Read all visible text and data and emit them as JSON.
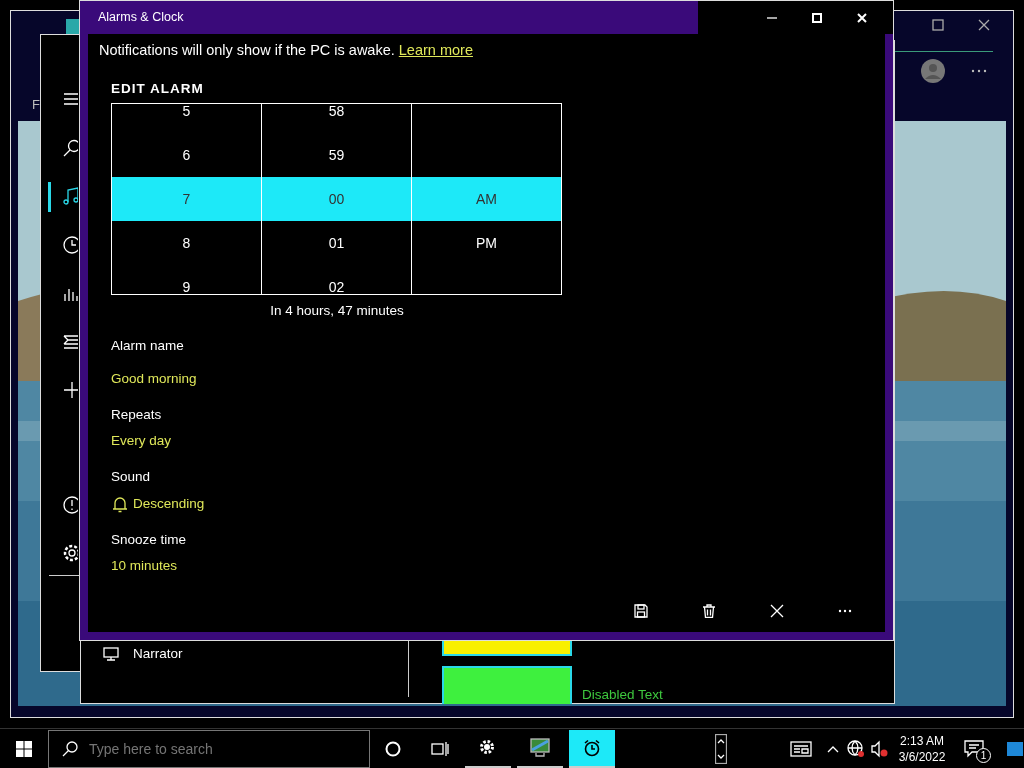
{
  "background_window": {
    "cut_text": "F",
    "narrator_label": "Narrator",
    "disabled_text": "Disabled Text"
  },
  "media_sidebar": [
    {
      "kind": "menu",
      "selected": false
    },
    {
      "kind": "search",
      "selected": false
    },
    {
      "kind": "music",
      "selected": true
    },
    {
      "kind": "clock",
      "selected": false
    },
    {
      "kind": "chart",
      "selected": false
    },
    {
      "kind": "list",
      "selected": false
    },
    {
      "kind": "add",
      "selected": false
    },
    {
      "kind": "info",
      "selected": false
    },
    {
      "kind": "settings",
      "selected": false
    }
  ],
  "window": {
    "title": "Alarms & Clock"
  },
  "notice": {
    "text": "Notifications will only show if the PC is awake.",
    "link": "Learn more"
  },
  "heading": "EDIT ALARM",
  "picker_rows": [
    {
      "hour": "5",
      "minute": "58",
      "selected": false
    },
    {
      "hour": "6",
      "minute": "59",
      "selected": false
    },
    {
      "hour": "7",
      "minute": "00",
      "period": "AM",
      "selected": true
    },
    {
      "hour": "8",
      "minute": "01",
      "period": "PM",
      "selected": false
    },
    {
      "hour": "9",
      "minute": "02",
      "selected": false
    }
  ],
  "countdown": "In 4 hours, 47 minutes",
  "fields": [
    {
      "kind": "text",
      "label": "Alarm name",
      "value": "Good morning"
    },
    {
      "kind": "text",
      "label": "Repeats",
      "value": "Every day"
    },
    {
      "kind": "sound",
      "label": "Sound",
      "value": "Descending"
    },
    {
      "kind": "text",
      "label": "Snooze time",
      "value": "10 minutes"
    }
  ],
  "commands": [
    {
      "kind": "save"
    },
    {
      "kind": "delete"
    },
    {
      "kind": "close"
    },
    {
      "kind": "more"
    }
  ],
  "taskbar": {
    "search_placeholder": "Type here to search",
    "apps": [
      {
        "kind": "settings",
        "selected": false
      },
      {
        "kind": "monitor",
        "selected": false
      },
      {
        "kind": "alarm",
        "selected": true
      }
    ],
    "time": "2:13 AM",
    "date": "3/6/2022",
    "notification_count": "1"
  }
}
